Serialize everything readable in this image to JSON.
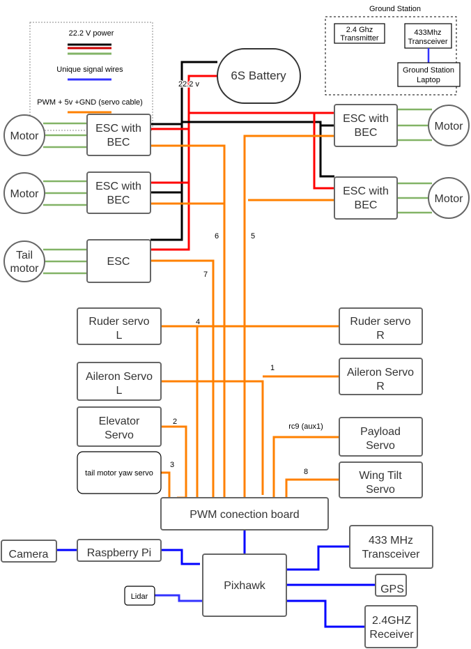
{
  "colors": {
    "power_black": "#000000",
    "power_red": "#ff0000",
    "motor_green": "#82b366",
    "signal_blue": "#0000ff",
    "servo_orange": "#ff8000"
  },
  "legend": {
    "power": "22.2 V power",
    "signal": "Unique signal wires",
    "servo": "PWM + 5v +GND (servo cable)"
  },
  "battery": {
    "label": "6S Battery",
    "voltage_label": "22.2 v"
  },
  "ground_station": {
    "title": "Ground Station",
    "transmitter": [
      "2.4 Ghz",
      "Transmitter"
    ],
    "transceiver": [
      "433Mhz",
      "Transceiver"
    ],
    "laptop": [
      "Ground Station",
      "Laptop"
    ]
  },
  "motors": {
    "m1": "Motor",
    "m2": "Motor",
    "m3": "Motor",
    "m4": "Motor",
    "tail": [
      "Tail",
      "motor"
    ]
  },
  "escs": {
    "e1": [
      "ESC with",
      "BEC"
    ],
    "e2": [
      "ESC with",
      "BEC"
    ],
    "e3": [
      "ESC with",
      "BEC"
    ],
    "e4": [
      "ESC with",
      "BEC"
    ],
    "tail": "ESC"
  },
  "servos": {
    "ruder_l": [
      "Ruder servo",
      "L"
    ],
    "ruder_r": [
      "Ruder servo",
      "R"
    ],
    "aileron_l": [
      "Aileron Servo",
      "L"
    ],
    "aileron_r": [
      "Aileron Servo",
      "R"
    ],
    "elevator": [
      "Elevator",
      "Servo"
    ],
    "tail_yaw": "tail motor yaw servo",
    "payload": [
      "Payload",
      "Servo"
    ],
    "wing_tilt": [
      "Wing Tilt",
      "Servo"
    ]
  },
  "channels": {
    "c1": "1",
    "c2": "2",
    "c3": "3",
    "c4": "4",
    "c5": "5",
    "c6": "6",
    "c7": "7",
    "c8": "8",
    "rc9": "rc9 (aux1)"
  },
  "boards": {
    "pwm": "PWM conection board",
    "pixhawk": "Pixhawk",
    "camera": "Camera",
    "raspberry_pi": "Raspberry Pi",
    "lidar": "Lidar",
    "transceiver": [
      "433 MHz",
      "Transceiver"
    ],
    "gps": "GPS",
    "receiver": [
      "2.4GHZ",
      "Receiver"
    ]
  }
}
